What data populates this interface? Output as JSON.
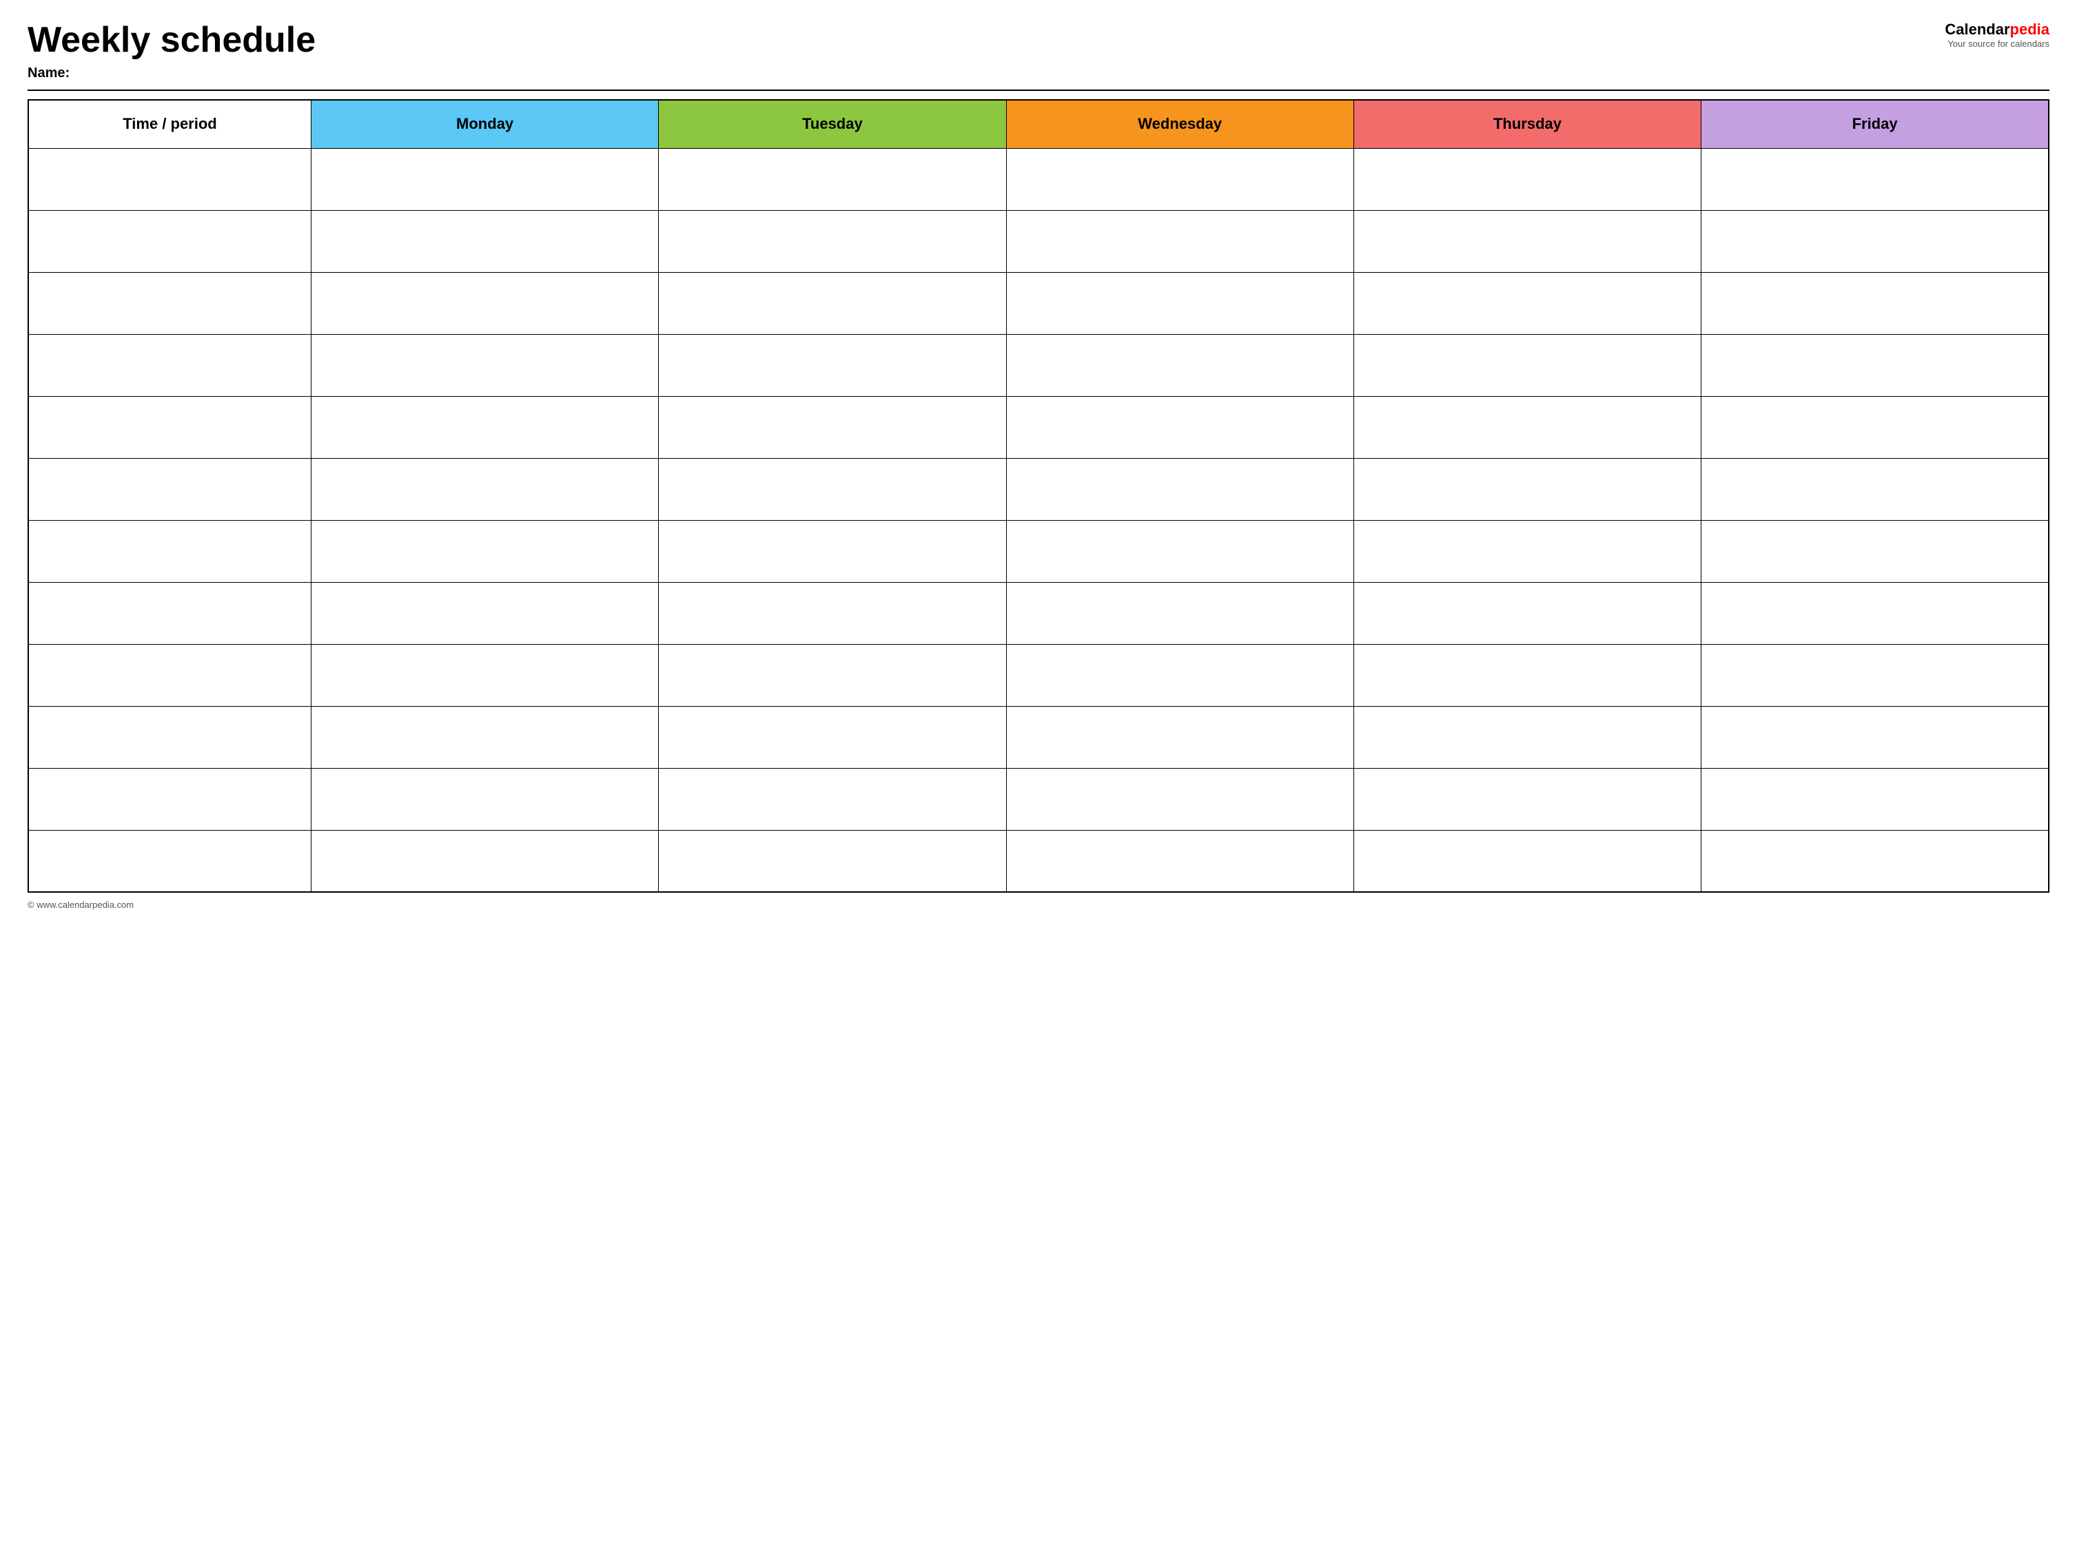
{
  "header": {
    "title": "Weekly schedule",
    "name_label": "Name:",
    "logo": {
      "calendar_text": "Calendar",
      "pedia_text": "pedia",
      "subtitle": "Your source for calendars"
    }
  },
  "table": {
    "columns": [
      {
        "label": "Time / period",
        "class": "th-time"
      },
      {
        "label": "Monday",
        "class": "th-monday"
      },
      {
        "label": "Tuesday",
        "class": "th-tuesday"
      },
      {
        "label": "Wednesday",
        "class": "th-wednesday"
      },
      {
        "label": "Thursday",
        "class": "th-thursday"
      },
      {
        "label": "Friday",
        "class": "th-friday"
      }
    ],
    "row_count": 12
  },
  "footer": {
    "text": "© www.calendarpedia.com"
  }
}
